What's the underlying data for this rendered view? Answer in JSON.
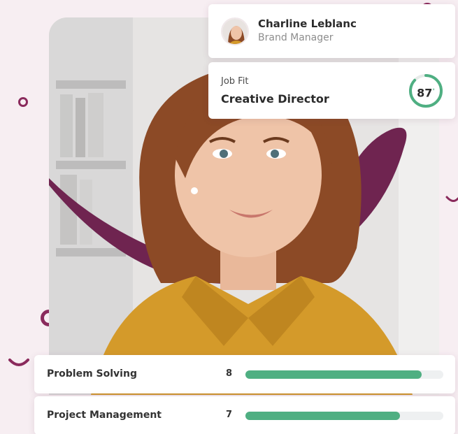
{
  "colors": {
    "accent": "#4faf82",
    "brand": "#8a2a5c",
    "background": "#f7eef2"
  },
  "profile": {
    "name": "Charline Leblanc",
    "role": "Brand Manager"
  },
  "job_fit": {
    "label": "Job Fit",
    "title": "Creative Director",
    "score": "87",
    "score_fraction": 0.87
  },
  "skills": [
    {
      "name": "Problem Solving",
      "value": "8",
      "fill_fraction": 0.89
    },
    {
      "name": "Project Management",
      "value": "7",
      "fill_fraction": 0.78
    }
  ]
}
